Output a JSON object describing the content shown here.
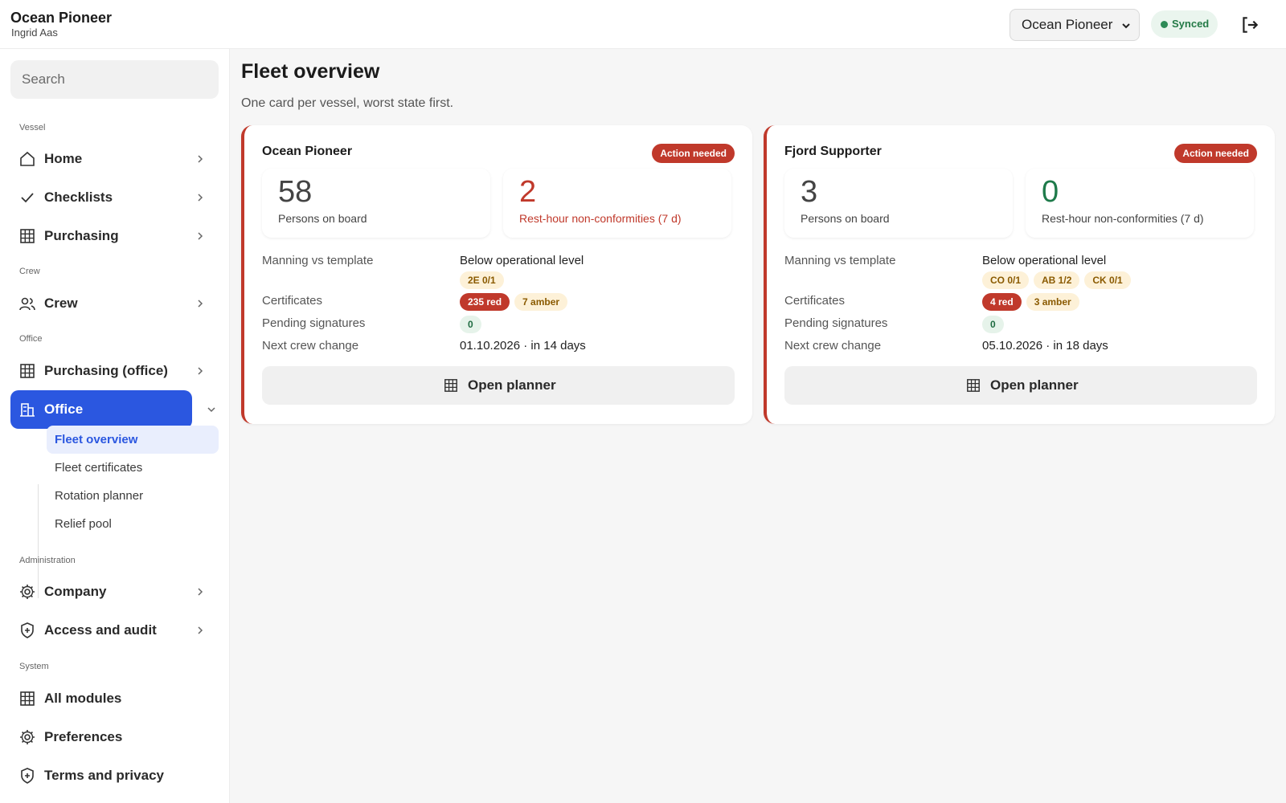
{
  "app": {
    "title": "Ocean Pioneer",
    "user": "Ingrid Aas"
  },
  "topbar": {
    "vessel_selected": "Ocean Pioneer",
    "sync_status": "Synced",
    "logout_icon": "logout-icon"
  },
  "sidebar": {
    "search_placeholder": "Search",
    "sections": {
      "vessel": "Vessel",
      "crew": "Crew",
      "office": "Office",
      "administration": "Administration",
      "system": "System"
    },
    "items": {
      "home": "Home",
      "checklists": "Checklists",
      "purchasing": "Purchasing",
      "crew": "Crew",
      "purchasing_office": "Purchasing (office)",
      "office": "Office",
      "company": "Company",
      "access_audit": "Access and audit",
      "all_modules": "All modules",
      "preferences": "Preferences",
      "terms": "Terms and privacy"
    },
    "office_sub": [
      "Fleet overview",
      "Fleet certificates",
      "Rotation planner",
      "Relief pool"
    ],
    "active": "Office",
    "active_sub": "Fleet overview"
  },
  "main": {
    "title": "Fleet overview",
    "subtitle": "One card per vessel, worst state first."
  },
  "vessels": [
    {
      "name": "Ocean Pioneer",
      "status": "Action needed",
      "persons_on_board": "58",
      "persons_label": "Persons on board",
      "nonconformities": "2",
      "nonconformities_label": "Rest-hour non-conformities (7 d)",
      "manning_label": "Manning vs template",
      "manning_value": "Below operational level",
      "manning_chips": [
        "2E 0/1"
      ],
      "certificates_label": "Certificates",
      "cert_red": "235 red",
      "cert_amber": "7 amber",
      "pending_label": "Pending signatures",
      "pending_value": "0",
      "next_change_label": "Next crew change",
      "next_change_value": "01.10.2026 · in 14 days",
      "planner_label": "Open planner"
    },
    {
      "name": "Fjord Supporter",
      "status": "Action needed",
      "persons_on_board": "3",
      "persons_label": "Persons on board",
      "nonconformities": "0",
      "nonconformities_label": "Rest-hour non-conformities (7 d)",
      "manning_label": "Manning vs template",
      "manning_value": "Below operational level",
      "manning_chips": [
        "CO 0/1",
        "AB 1/2",
        "CK 0/1"
      ],
      "certificates_label": "Certificates",
      "cert_red": "4 red",
      "cert_amber": "3 amber",
      "pending_label": "Pending signatures",
      "pending_value": "0",
      "next_change_label": "Next crew change",
      "next_change_value": "05.10.2026 · in 18 days",
      "planner_label": "Open planner"
    }
  ],
  "colors": {
    "accent": "#2b57e0",
    "danger": "#c0392b",
    "ok": "#1e7a4a",
    "amber": "#8a5a00"
  }
}
